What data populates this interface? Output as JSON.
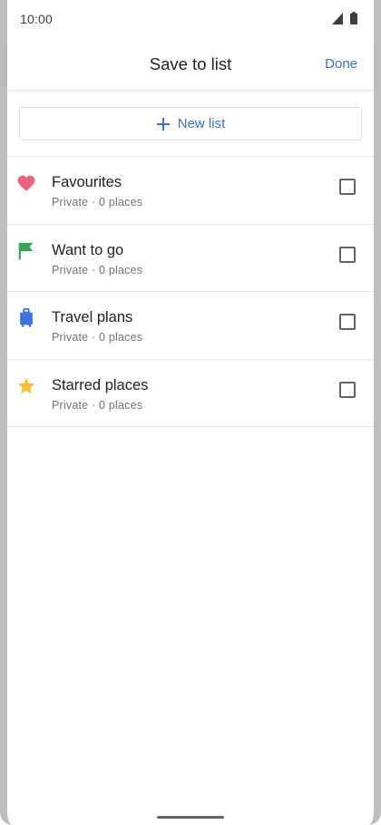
{
  "status_bar": {
    "time": "10:00",
    "icons": [
      "signal-icon",
      "battery-icon"
    ]
  },
  "header": {
    "title": "Save to list",
    "done_label": "Done"
  },
  "new_list": {
    "icon": "plus-icon",
    "label": "New list"
  },
  "lists": [
    {
      "title": "Favourites",
      "subtitle": "Private · 0 places",
      "icon": "heart-icon",
      "color": "#e8637f",
      "checked": false
    },
    {
      "title": "Want to go",
      "subtitle": "Private · 0 places",
      "icon": "flag-icon",
      "color": "#3ca35a",
      "checked": false
    },
    {
      "title": "Travel plans",
      "subtitle": "Private · 0 places",
      "icon": "suitcase-icon",
      "color": "#3f74d6",
      "checked": false
    },
    {
      "title": "Starred places",
      "subtitle": "Private · 0 places",
      "icon": "star-icon",
      "color": "#f4bf3a",
      "checked": false
    }
  ],
  "colors": {
    "accent": "#3b6fc4",
    "text_primary": "#202124",
    "text_secondary": "#70757a"
  }
}
